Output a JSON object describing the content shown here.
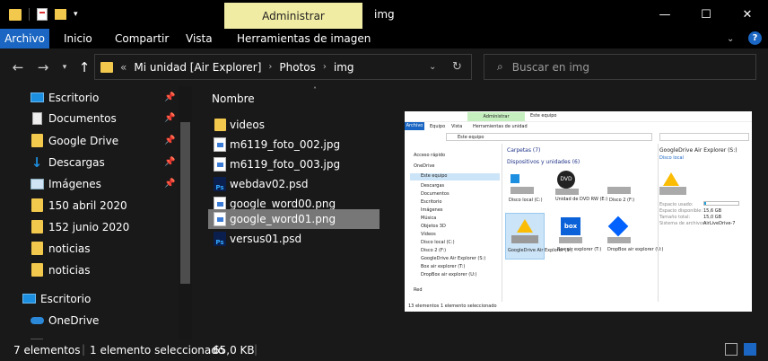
{
  "window": {
    "title": "img",
    "context_tab": "Administrar",
    "controls": {
      "minimize": "—",
      "maximize": "☐",
      "close": "✕"
    }
  },
  "ribbon": {
    "tabs": [
      "Archivo",
      "Inicio",
      "Compartir",
      "Vista",
      "Herramientas de imagen"
    ],
    "active": "Archivo",
    "accent": "#1a66c2"
  },
  "address": {
    "path": [
      "Mi unidad [Air Explorer]",
      "Photos",
      "img"
    ],
    "overflow": "«"
  },
  "search": {
    "placeholder": "Buscar en img"
  },
  "nav": {
    "items": [
      {
        "label": "Escritorio",
        "icon": "desktop-icon",
        "pinned": true
      },
      {
        "label": "Documentos",
        "icon": "documents-icon",
        "pinned": true
      },
      {
        "label": "Google Drive",
        "icon": "folder-icon",
        "pinned": true
      },
      {
        "label": "Descargas",
        "icon": "download-icon",
        "pinned": true
      },
      {
        "label": "Imágenes",
        "icon": "pictures-icon",
        "pinned": true
      },
      {
        "label": "150 abril 2020",
        "icon": "folder-icon",
        "pinned": false
      },
      {
        "label": "152 junio 2020",
        "icon": "folder-icon",
        "pinned": false
      },
      {
        "label": "noticias",
        "icon": "folder-icon",
        "pinned": false
      },
      {
        "label": "noticias",
        "icon": "folder-icon",
        "pinned": false
      },
      {
        "label": "Escritorio",
        "icon": "desktop-icon",
        "pinned": false
      },
      {
        "label": "OneDrive",
        "icon": "cloud-icon",
        "pinned": false
      }
    ]
  },
  "list": {
    "header": "Nombre",
    "files": [
      {
        "name": "videos",
        "type": "folder"
      },
      {
        "name": "m6119_foto_002.jpg",
        "type": "image"
      },
      {
        "name": "m6119_foto_003.jpg",
        "type": "image"
      },
      {
        "name": "webdav02.psd",
        "type": "psd"
      },
      {
        "name": "google_word00.png",
        "type": "image"
      },
      {
        "name": "google_word01.png",
        "type": "image",
        "selected": true
      },
      {
        "name": "versus01.psd",
        "type": "psd"
      }
    ]
  },
  "preview": {
    "context_tab": "Administrar",
    "title": "Este equipo",
    "tabs": [
      "Archivo",
      "Equipo",
      "Vista",
      "Herramientas de unidad"
    ],
    "address": "Este equipo",
    "nav": [
      "Acceso rápido",
      "OneDrive",
      "Este equipo",
      "Descargas",
      "Documentos",
      "Escritorio",
      "Imágenes",
      "Música",
      "Objetos 3D",
      "Vídeos",
      "Disco local (C:)",
      "Disco 2 (F:)",
      "GoogleDrive Air Explorer (S:)",
      "Box air explorer (T:)",
      "DropBox air explorer (U:)",
      "Red"
    ],
    "sections": {
      "folders": "Carpetas (7)",
      "devices": "Dispositivos y unidades (6)"
    },
    "drives": [
      "Disco local (C:)",
      "Unidad de DVD RW (E:)",
      "Disco 2 (F:)",
      "GoogleDrive Air Explorer (S:)",
      "Box air explorer (T:)",
      "DropBox air explorer (U:)"
    ],
    "details": {
      "name": "GoogleDrive Air Explorer (S:)",
      "type": "Disco local",
      "used_label": "Espacio usado:",
      "free_label": "Espacio disponible:",
      "free": "15,6 GB",
      "size_label": "Tamaño total:",
      "size": "15,0 GB",
      "fs_label": "Sistema de archivos:",
      "fs": "AirLiveDrive-7"
    },
    "status": [
      "13 elementos",
      "1 elemento seleccionado"
    ],
    "dvd_text": "DVD",
    "box_text": "box"
  },
  "status": {
    "count": "7 elementos",
    "selected": "1 elemento seleccionado",
    "size": "65,0 KB"
  }
}
